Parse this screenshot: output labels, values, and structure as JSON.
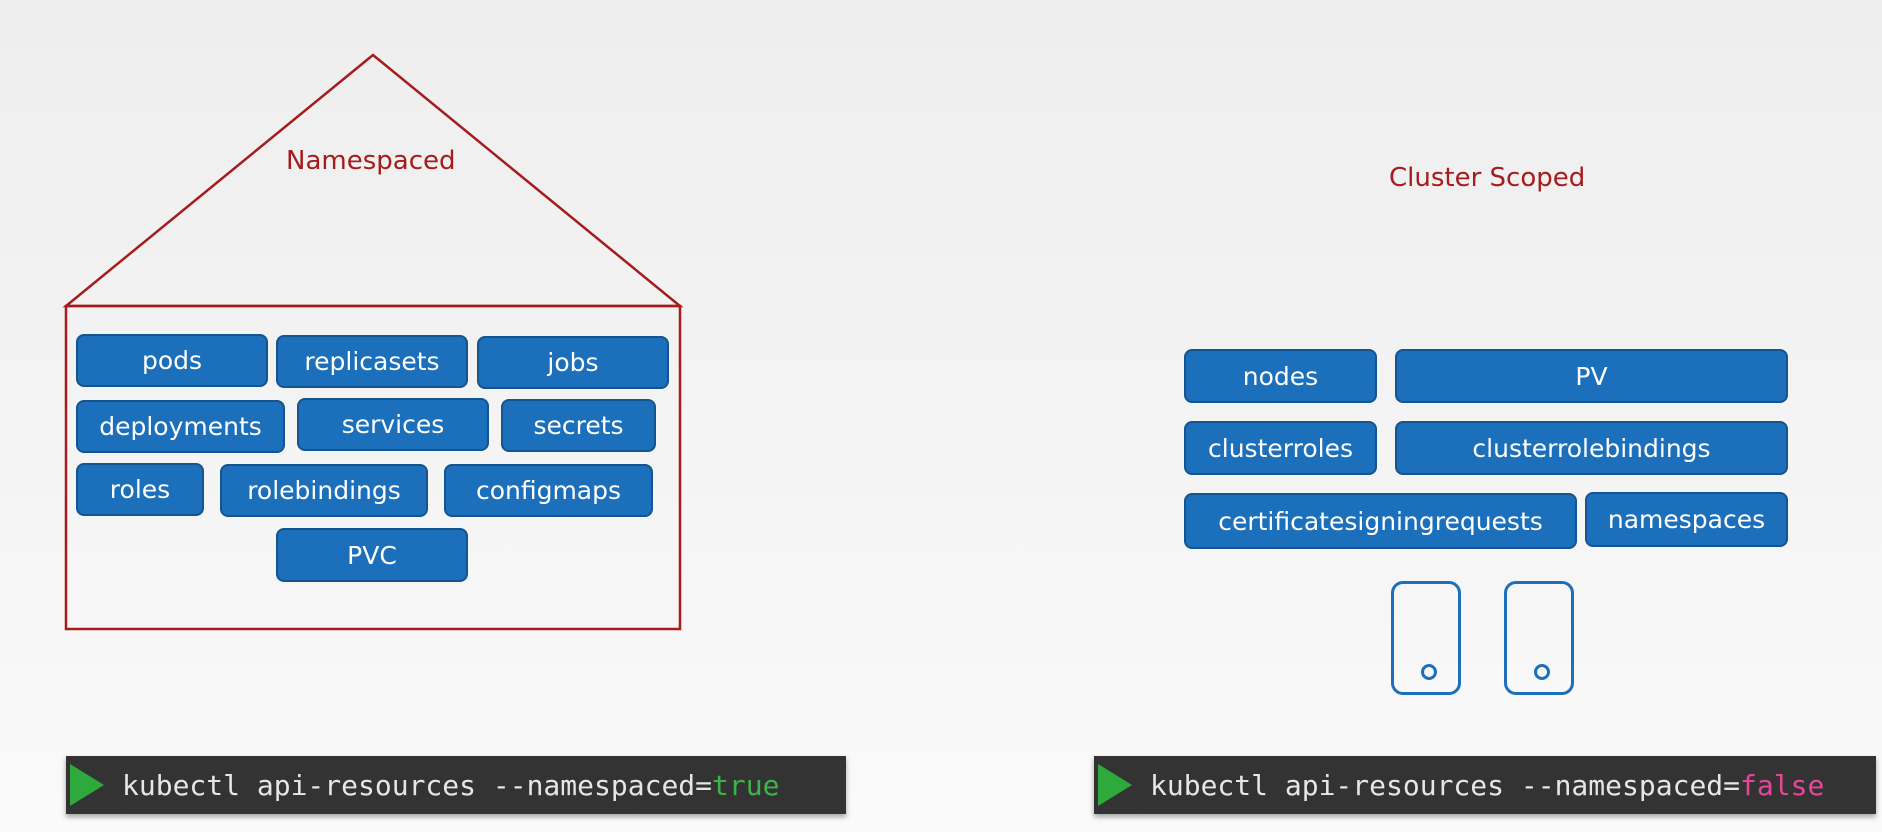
{
  "namespaced": {
    "title": "Namespaced",
    "resources": [
      "pods",
      "replicasets",
      "jobs",
      "deployments",
      "services",
      "secrets",
      "roles",
      "rolebindings",
      "configmaps",
      "PVC"
    ],
    "command": {
      "text": "kubectl api-resources --namespaced=",
      "value": "true"
    }
  },
  "cluster": {
    "title": "Cluster Scoped",
    "resources": [
      "nodes",
      "PV",
      "clusterroles",
      "clusterrolebindings",
      "certificatesigningrequests",
      "namespaces"
    ],
    "command": {
      "text": "kubectl api-resources --namespaced=",
      "value": "false"
    }
  },
  "colors": {
    "accent_red": "#a61c1c",
    "chip_blue": "#1b6fbb",
    "terminal_bg": "#333333",
    "true_green": "#3bb54a",
    "false_pink": "#e8459a"
  }
}
